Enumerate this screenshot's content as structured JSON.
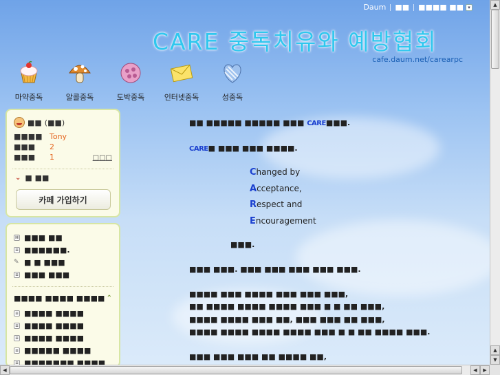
{
  "topbar": {
    "daum": "Daum",
    "link1": "■■",
    "link2": "■■■■ ■■",
    "arrow": "▾"
  },
  "header": {
    "title": "CARE 중독치유와 예방협회",
    "url": "cafe.daum.net/carearpc"
  },
  "nav": {
    "items": [
      {
        "label": "마약중독",
        "icon": "cupcake-icon"
      },
      {
        "label": "알콜중독",
        "icon": "mushroom-icon"
      },
      {
        "label": "도박중독",
        "icon": "pink-ball-icon"
      },
      {
        "label": "인터넷중독",
        "icon": "envelope-icon"
      },
      {
        "label": "성중독",
        "icon": "heart-icon"
      }
    ]
  },
  "profile": {
    "name": "■■",
    "grade": "(■■)",
    "rows": [
      {
        "label": "■■■■",
        "value": "Tony"
      },
      {
        "label": "■■■",
        "value": "2"
      },
      {
        "label": "■■■",
        "value": "1"
      }
    ],
    "more": "□□□",
    "collapse_label": "■ ■■",
    "join_button": "카페 가입하기"
  },
  "menu": {
    "top_items": [
      {
        "label": "■■■ ■■",
        "icon": "H"
      },
      {
        "label": "■■■■■■.",
        "icon": "≡"
      },
      {
        "label": "■ ■ ■■■",
        "icon": "✎"
      },
      {
        "label": "■■■ ■■■",
        "icon": "≡"
      }
    ],
    "section_title": "■■■■ ■■■■ ■■■■",
    "section_items": [
      "■■■■ ■■■■",
      "■■■■ ■■■■",
      "■■■■ ■■■■",
      "■■■■■ ■■■■",
      "■■■■■■■ ■■■■"
    ]
  },
  "content": {
    "p1_pre": "■■ ■■■■■ ■■■■■ ■■■ ",
    "p1_care": "CARE",
    "p1_post": "■■■.",
    "p2_care": "CARE",
    "p2_post": "■ ■■■ ■■■ ■■■■.",
    "acronym": [
      {
        "cap": "C",
        "rest": "hanged by"
      },
      {
        "cap": "A",
        "rest": "cceptance,"
      },
      {
        "cap": "R",
        "rest": "espect and"
      },
      {
        "cap": "E",
        "rest": "ncouragement"
      }
    ],
    "note": "■■■.",
    "p3": "■■■ ■■■. ■■■ ■■■ ■■■ ■■■ ■■■.",
    "p4_lines": [
      "■■■■ ■■■ ■■■■ ■■■ ■■■ ■■■,",
      "■■ ■■■■ ■■■■ ■■■■ ■■■ ■ ■ ■■ ■■■,",
      "■■■■ ■■■■ ■■■ ■■, ■■■ ■■■ ■■ ■■■,",
      "■■■■ ■■■■ ■■■■ ■■■■ ■■■ ■ ■ ■■ ■■■■ ■■■."
    ],
    "p5_lines": [
      "■■■ ■■■ ■■■ ■■ ■■■■ ■■,",
      "■■■■■■, ■ ■■ ■■■ ■■"
    ]
  },
  "colors": {
    "title": "#2fc7ee",
    "accent_blue": "#1a3fcf",
    "profile_value": "#e4641e",
    "sidebar_bg": "#fbfbe8",
    "sidebar_border": "#d7e6a3"
  }
}
